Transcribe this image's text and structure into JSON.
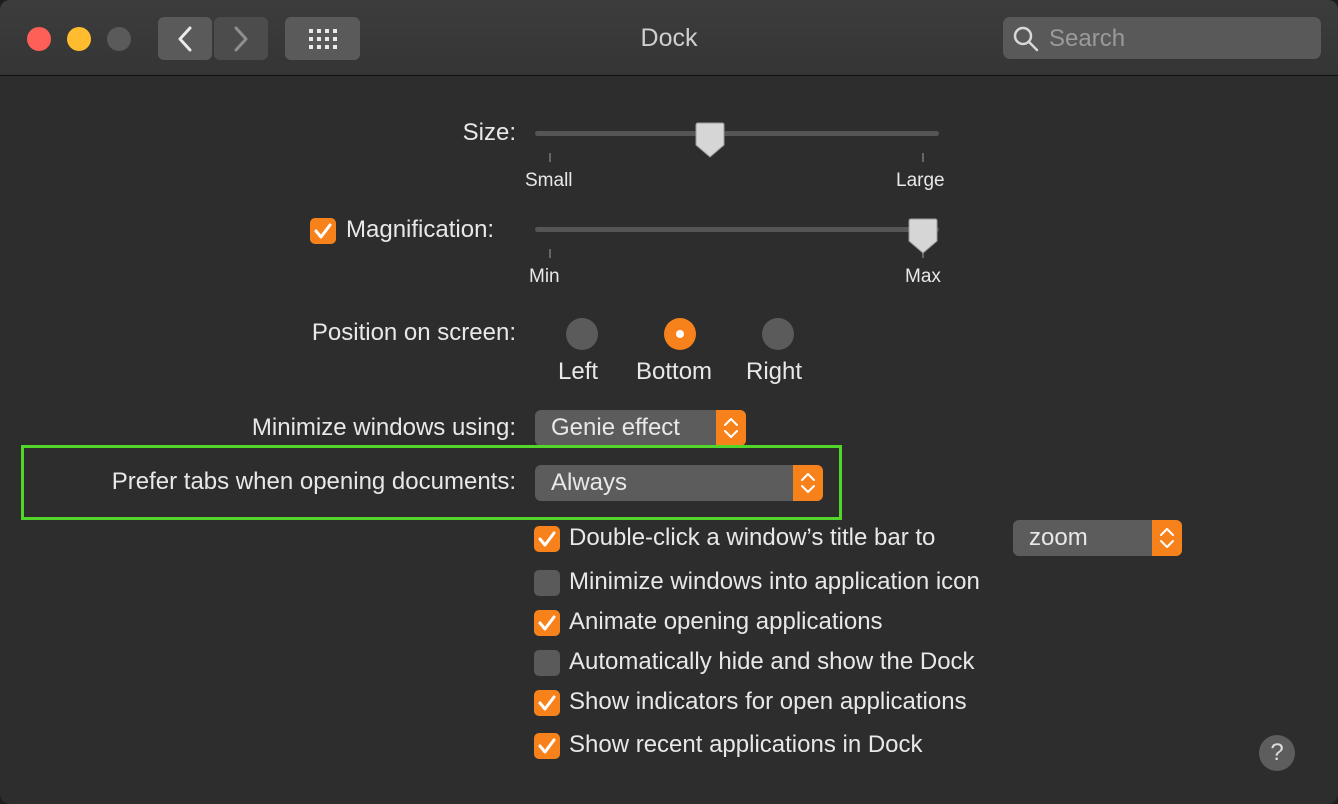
{
  "window": {
    "title": "Dock"
  },
  "search": {
    "placeholder": "Search"
  },
  "size": {
    "label": "Size:",
    "min_label": "Small",
    "max_label": "Large",
    "value_fraction": 0.43
  },
  "magnification": {
    "label": "Magnification:",
    "checked": true,
    "min_label": "Min",
    "max_label": "Max",
    "value_fraction": 0.96
  },
  "position": {
    "label": "Position on screen:",
    "options": [
      "Left",
      "Bottom",
      "Right"
    ],
    "selected": "Bottom"
  },
  "minimize_using": {
    "label": "Minimize windows using:",
    "value": "Genie effect"
  },
  "prefer_tabs": {
    "label": "Prefer tabs when opening documents:",
    "value": "Always"
  },
  "double_click": {
    "label": "Double-click a window’s title bar to",
    "checked": true,
    "value": "zoom"
  },
  "checkboxes": [
    {
      "label": "Minimize windows into application icon",
      "checked": false
    },
    {
      "label": "Animate opening applications",
      "checked": true
    },
    {
      "label": "Automatically hide and show the Dock",
      "checked": false
    },
    {
      "label": "Show indicators for open applications",
      "checked": true
    },
    {
      "label": "Show recent applications in Dock",
      "checked": true
    }
  ],
  "help": {
    "label": "?"
  },
  "colors": {
    "accent": "#f7821b",
    "highlight_border": "#52d62a",
    "background": "#2d2d2d"
  },
  "icons": [
    "close-icon",
    "minimize-icon",
    "zoom-icon",
    "back-chevron-icon",
    "forward-chevron-icon",
    "grid-icon",
    "search-icon",
    "checkmark-icon",
    "stepper-icon"
  ]
}
